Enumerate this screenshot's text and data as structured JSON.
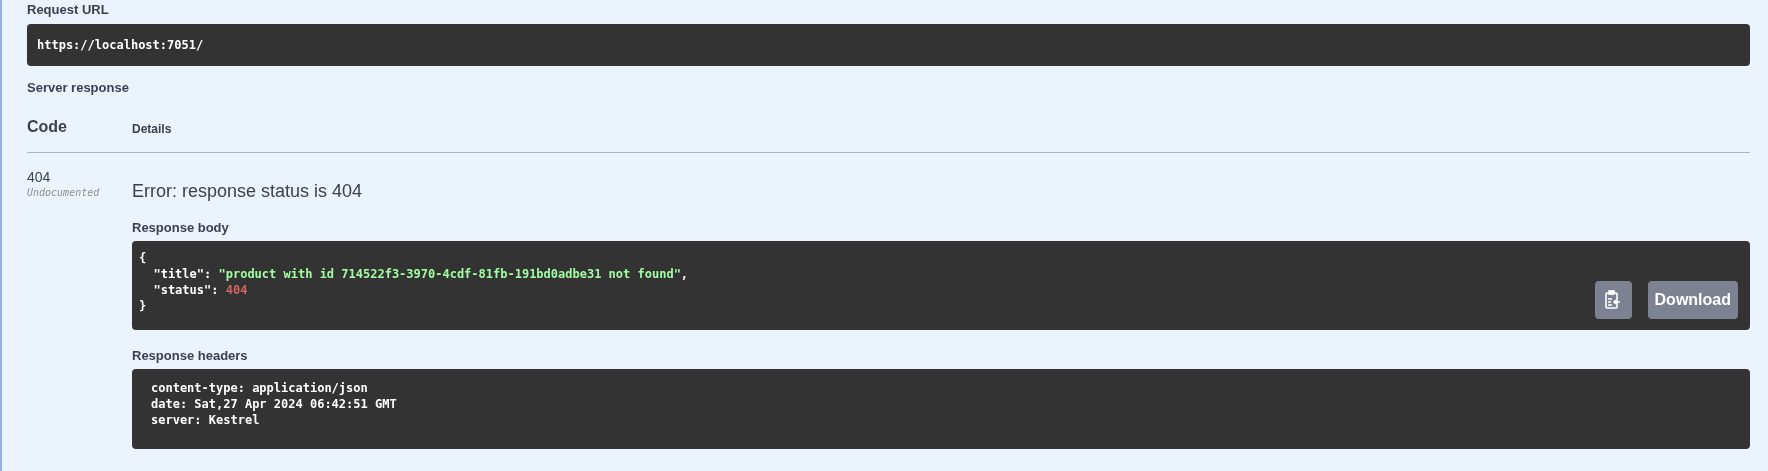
{
  "request_url": {
    "label": "Request URL",
    "value": "https://localhost:7051/"
  },
  "server_response": {
    "label": "Server response",
    "columns": [
      "Code",
      "Details"
    ],
    "rows": [
      {
        "code": "404",
        "note": "Undocumented",
        "error": "Error: response status is 404",
        "body_label": "Response body",
        "body_lines": [
          [
            {
              "kind": "punct",
              "text": "{"
            }
          ],
          [
            {
              "kind": "key",
              "text": "  \"title\": "
            },
            {
              "kind": "string",
              "text": "\"product with id 714522f3-3970-4cdf-81fb-191bd0adbe31 not found\""
            },
            {
              "kind": "punct",
              "text": ","
            }
          ],
          [
            {
              "kind": "key",
              "text": "  \"status\": "
            },
            {
              "kind": "number",
              "text": "404"
            }
          ],
          [
            {
              "kind": "punct",
              "text": "}"
            }
          ]
        ],
        "download": "Download",
        "headers_label": "Response headers",
        "header_lines": [
          "content-type: application/json",
          "date: Sat,27 Apr 2024 06:42:51 GMT",
          "server: Kestrel"
        ]
      }
    ]
  }
}
